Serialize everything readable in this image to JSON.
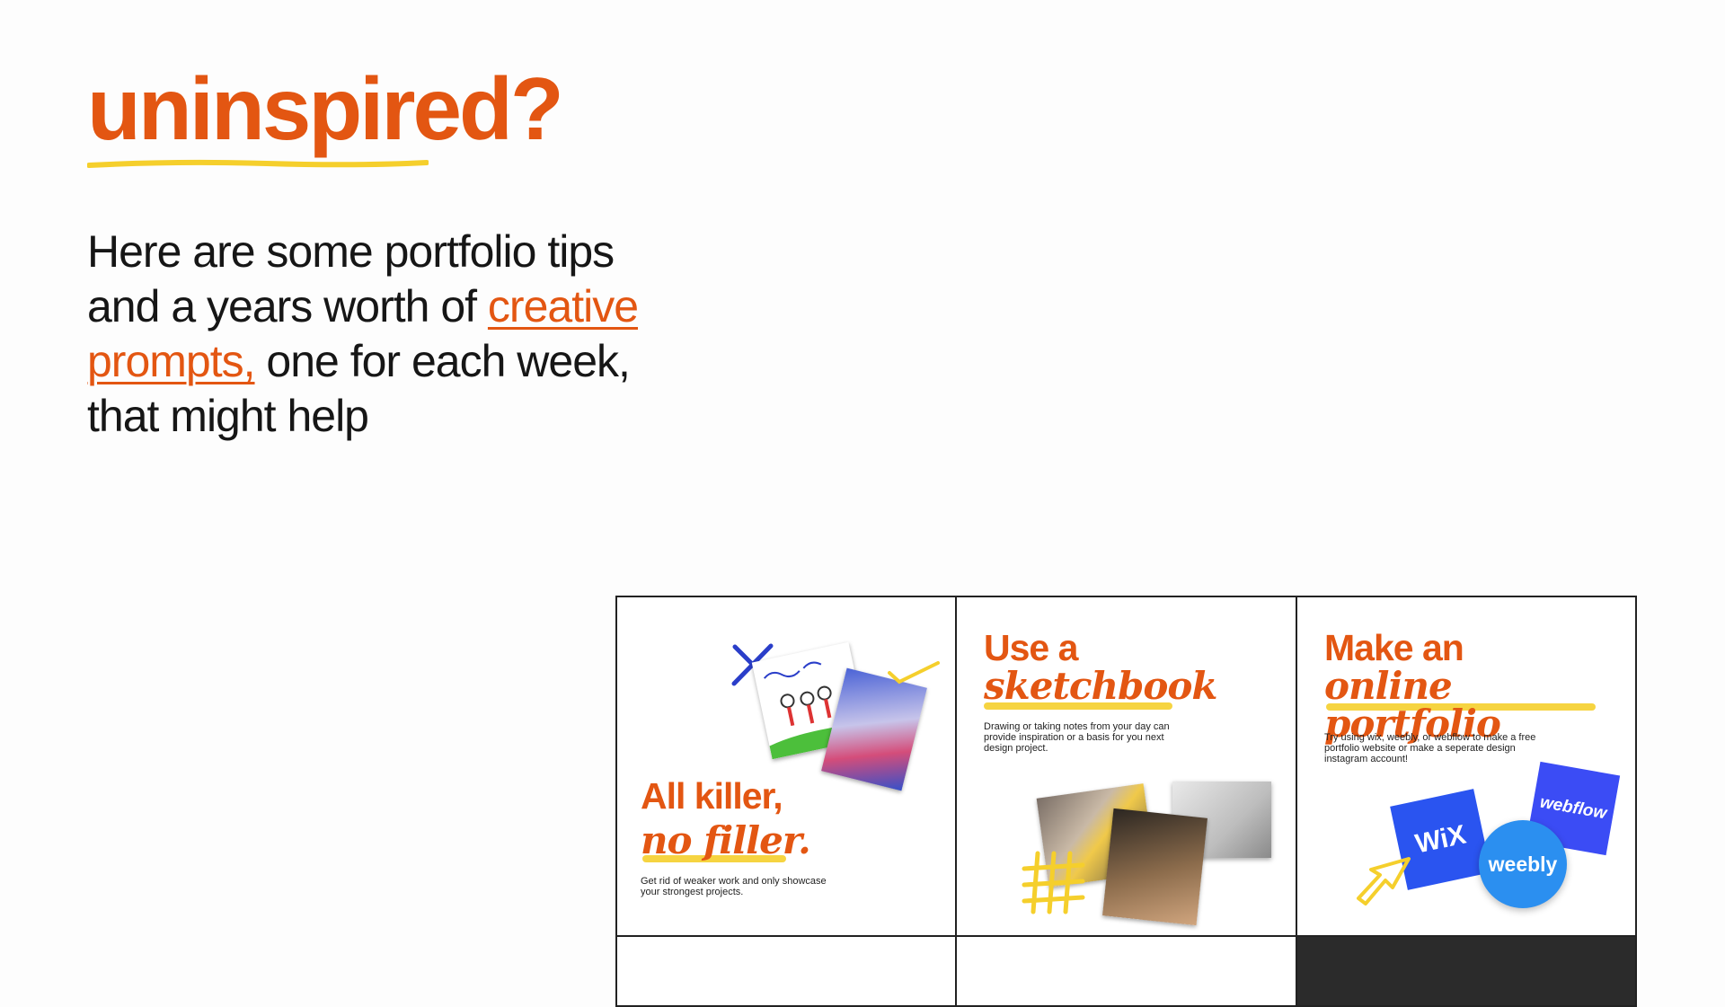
{
  "hero": {
    "title": "uninspired?",
    "intro_before": "Here are some portfolio tips and a years worth of ",
    "intro_link": "creative prompts,",
    "intro_after": " one for each week, that might help"
  },
  "cards": [
    {
      "title_sans": "All killer,",
      "title_serif": "no filler.",
      "description": "Get rid of weaker work and only showcase your strongest projects."
    },
    {
      "title_sans": "Use a",
      "title_serif": "sketchbook",
      "description": "Drawing or taking notes from your day can provide inspiration or a basis for you next design project."
    },
    {
      "title_sans": "Make an",
      "title_serif": "online portfolio",
      "description": "Try using wix, weebly, or webflow to make a free portfolio website or make a seperate design instagram account!",
      "logos": {
        "wix": "WiX",
        "weebly": "weebly",
        "webflow": "webflow"
      }
    }
  ],
  "colors": {
    "accent": "#e35612",
    "highlight": "#f5cf2c",
    "wix_blue": "#2a54f0",
    "weebly_blue": "#2b8ff0",
    "webflow_blue": "#3b4cf5"
  }
}
